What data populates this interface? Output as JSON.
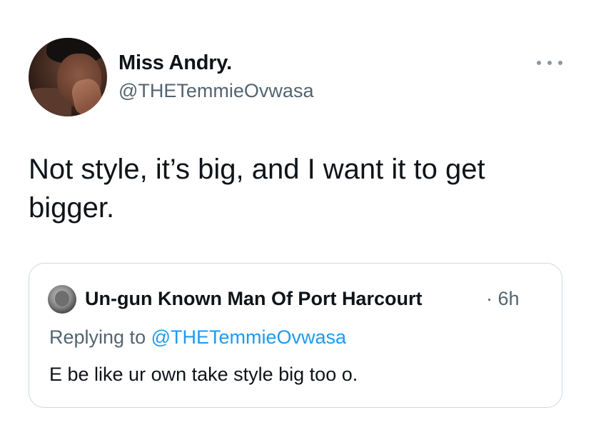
{
  "author": {
    "display_name": "Miss Andry.",
    "handle": "@THETemmieOvwasa",
    "avatar_icon": "profile-photo"
  },
  "more_icon": "ellipsis-icon",
  "tweet_text": "Not style, it’s big, and I want it to get\nbigger.",
  "quoted_tweet": {
    "display_name": "Un-gun Known Man Of Port Harcourt",
    "separator": "·",
    "time": "6h",
    "replying_label": "Replying to",
    "replying_to": "@THETemmieOvwasa",
    "text": "E be like ur own take style big too o.",
    "colors": {
      "mention": "#1d9bf0",
      "secondary": "#536471",
      "border": "#cfd9de"
    }
  }
}
